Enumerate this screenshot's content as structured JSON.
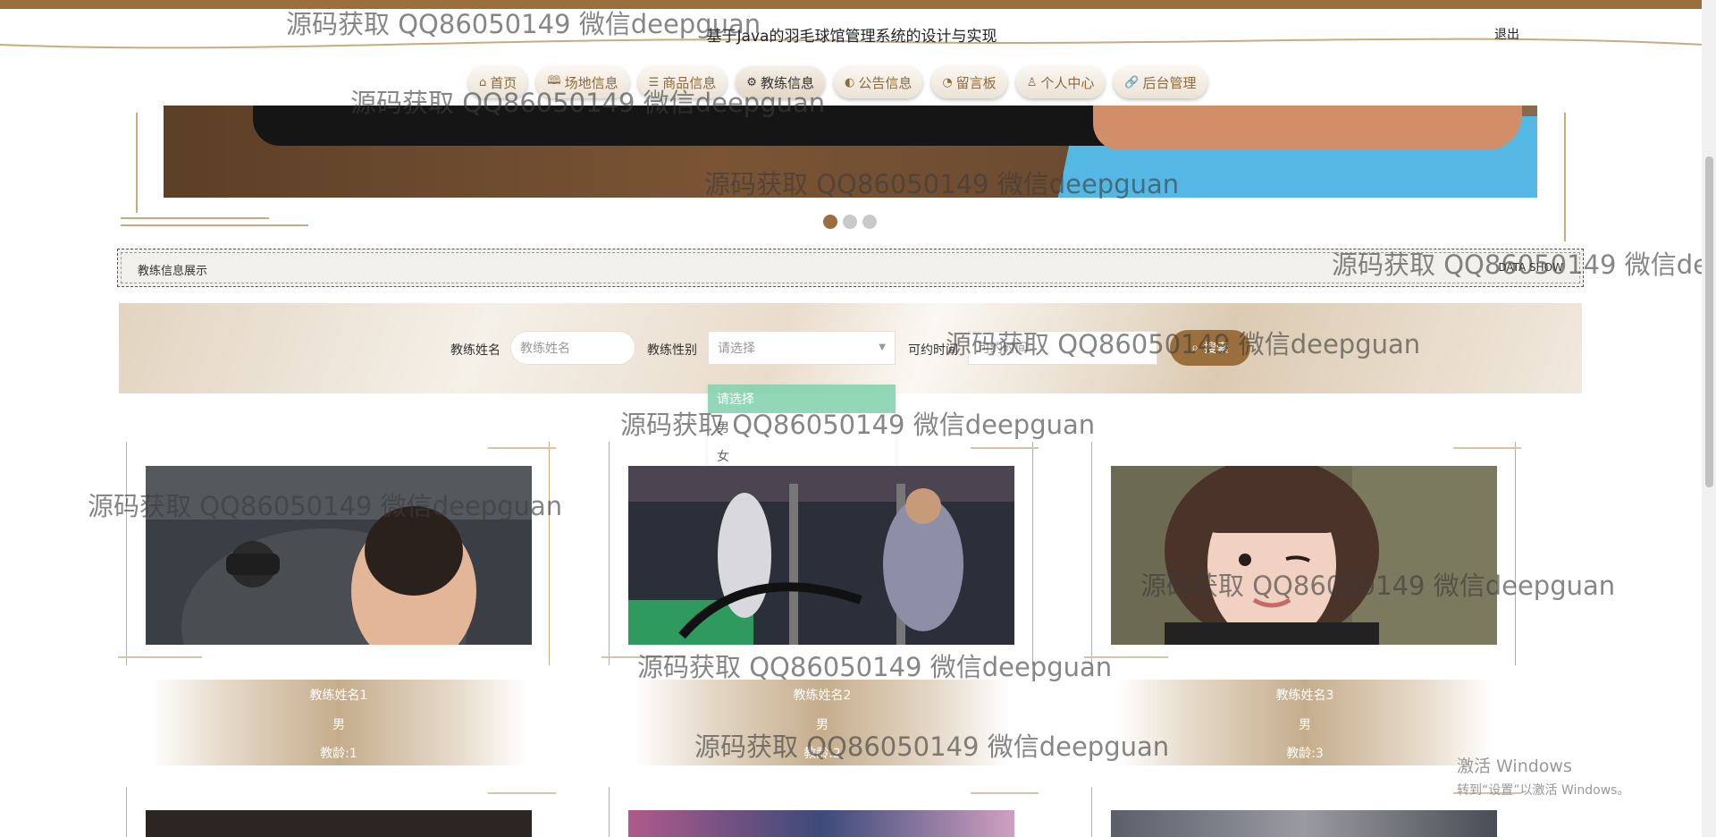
{
  "header": {
    "title": "基于Java的羽毛球馆管理系统的设计与实现",
    "logout_label": "退出"
  },
  "nav": [
    {
      "label": "首页",
      "icon": "home-icon",
      "glyph": "⌂"
    },
    {
      "label": "场地信息",
      "icon": "book-icon",
      "glyph": "🕮"
    },
    {
      "label": "商品信息",
      "icon": "layers-icon",
      "glyph": "☰"
    },
    {
      "label": "教练信息",
      "icon": "gear-icon",
      "glyph": "⚙",
      "active": true
    },
    {
      "label": "公告信息",
      "icon": "palette-icon",
      "glyph": "◐"
    },
    {
      "label": "留言板",
      "icon": "dashboard-icon",
      "glyph": "◔"
    },
    {
      "label": "个人中心",
      "icon": "user-icon",
      "glyph": "♙"
    },
    {
      "label": "后台管理",
      "icon": "link-icon",
      "glyph": "🔗"
    }
  ],
  "carousel": {
    "dot_count": 3,
    "active_index": 0
  },
  "section": {
    "title": "教练信息展示",
    "title_en": "DATA SHOW"
  },
  "search": {
    "name_label": "教练姓名",
    "name_placeholder": "教练姓名",
    "gender_label": "教练性别",
    "gender_value": "请选择",
    "time_label": "可约时间",
    "time_placeholder": "可约时间",
    "button_label": "搜索",
    "gender_options": [
      "请选择",
      "男",
      "女"
    ]
  },
  "coaches": [
    {
      "name": "教练姓名1",
      "gender": "男",
      "years": "教龄:1"
    },
    {
      "name": "教练姓名2",
      "gender": "男",
      "years": "教龄:2"
    },
    {
      "name": "教练姓名3",
      "gender": "男",
      "years": "教龄:3"
    }
  ],
  "watermark_text": "源码获取 QQ86050149 微信deepguan",
  "windows": {
    "line1": "激活 Windows",
    "line2": "转到“设置”以激活 Windows。"
  },
  "colors": {
    "accent": "#9a6f3c",
    "dropdown_selected": "#87d3b0"
  }
}
